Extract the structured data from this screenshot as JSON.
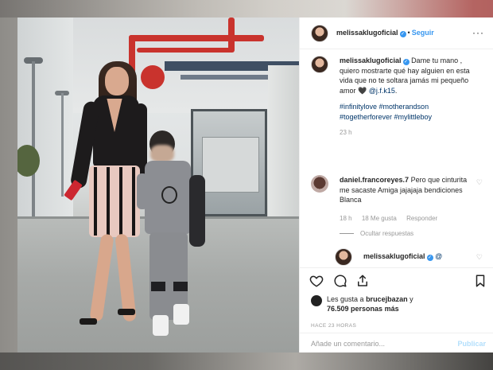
{
  "post": {
    "author": {
      "username": "melissaklugoficial",
      "follow_label": "Seguir",
      "separator": "•"
    },
    "more_label": "···",
    "caption": {
      "text": "Dame tu mano , quiero mostrarte qué hay alguien en esta vida que no te soltara jamás mi pequeño amor",
      "heart": "🖤",
      "mention": "@j.f.k15",
      "mention_tail": ".",
      "hashtags": "#infinitylove #motherandson #togetherforever #mylittleboy",
      "time": "23 h"
    },
    "comments": [
      {
        "username": "daniel.francoreyes.7",
        "text": "Pero que cinturita me sacaste Amiga jajajaja bendiciones Blanca",
        "time": "18 h",
        "likes": "18 Me gusta",
        "reply": "Responder",
        "hide_replies": "Ocultar respuestas"
      },
      {
        "username": "melissaklugoficial",
        "text": "@"
      }
    ],
    "actions": {
      "like_icon": "heart-outline-icon",
      "comment_icon": "speech-bubble-icon",
      "share_icon": "share-icon",
      "save_icon": "bookmark-icon"
    },
    "likes": {
      "prefix": "Les gusta a",
      "user": "brucejbazan",
      "conj": "y",
      "count": "76.509",
      "suffix": "personas más"
    },
    "timestamp": "HACE 23 HORAS",
    "add_comment": {
      "placeholder": "Añade un comentario...",
      "publish": "Publicar"
    }
  },
  "colors": {
    "link": "#003569",
    "accent_blue": "#3897f0",
    "publish_disabled": "#b2dffc",
    "muted": "#999999"
  }
}
